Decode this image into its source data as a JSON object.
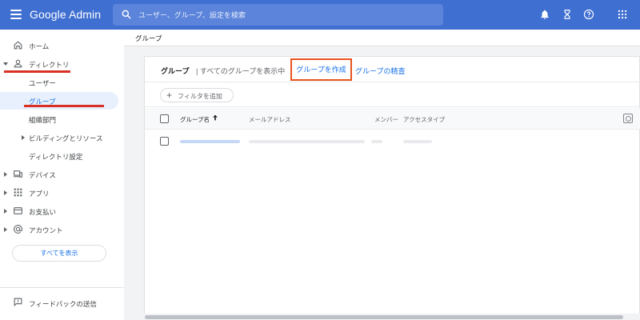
{
  "topbar": {
    "brand": "Google Admin",
    "search_placeholder": "ユーザー、グループ、設定を検索",
    "colors": {
      "bar": "#3f6fd1",
      "search": "#5b84da"
    },
    "icons": [
      "menu-icon",
      "search-icon",
      "bell-icon",
      "hourglass-icon",
      "help-icon",
      "apps-grid-icon"
    ]
  },
  "sidebar": {
    "home": "ホーム",
    "directory": "ディレクトリ",
    "users": "ユーザー",
    "groups": "グループ",
    "org_units": "組織部門",
    "buildings": "ビルディングとリソース",
    "directory_settings": "ディレクトリ設定",
    "devices": "デバイス",
    "apps": "アプリ",
    "billing": "お支払い",
    "account": "アカウント",
    "show_all": "すべてを表示",
    "feedback": "フィードバックの送信"
  },
  "main": {
    "breadcrumb": "グループ",
    "card_title": "グループ",
    "card_subtitle": "| すべてのグループを表示中",
    "create_group": "グループを作成",
    "search_groups": "グループの精査",
    "add_filter": "フィルタを追加",
    "columns": {
      "name": "グループ名",
      "email": "メールアドレス",
      "members": "メンバー",
      "access_type": "アクセスタイプ"
    },
    "accent_color": "#1a73e8",
    "highlight_color": "#e8541e"
  }
}
